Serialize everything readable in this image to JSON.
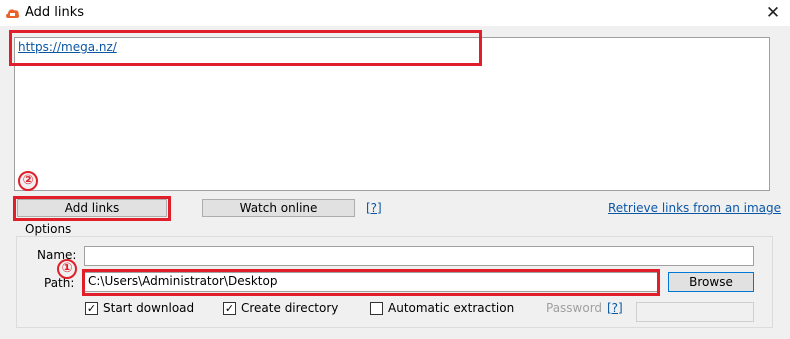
{
  "window": {
    "title": "Add links",
    "close_glyph": "✕",
    "app_icon": "mega-cloud-icon",
    "accent": "#e01f2b"
  },
  "links": {
    "text": "https://mega.nz/"
  },
  "actions": {
    "add_links": "Add links",
    "watch_online": "Watch online",
    "help": "[?]",
    "retrieve": "Retrieve links from an image"
  },
  "options": {
    "title": "Options",
    "name_label": "Name:",
    "name_value": "",
    "path_label": "Path:",
    "path_value": "C:\\Users\\Administrator\\Desktop",
    "browse": "Browse",
    "start_download": {
      "label": "Start download",
      "checked": true
    },
    "create_directory": {
      "label": "Create directory",
      "checked": true
    },
    "automatic_extraction": {
      "label": "Automatic extraction",
      "checked": false
    },
    "password_label": "Password",
    "password_help": "[?]",
    "password_value": ""
  },
  "annotations": {
    "marker_1": "①",
    "marker_2": "②"
  }
}
